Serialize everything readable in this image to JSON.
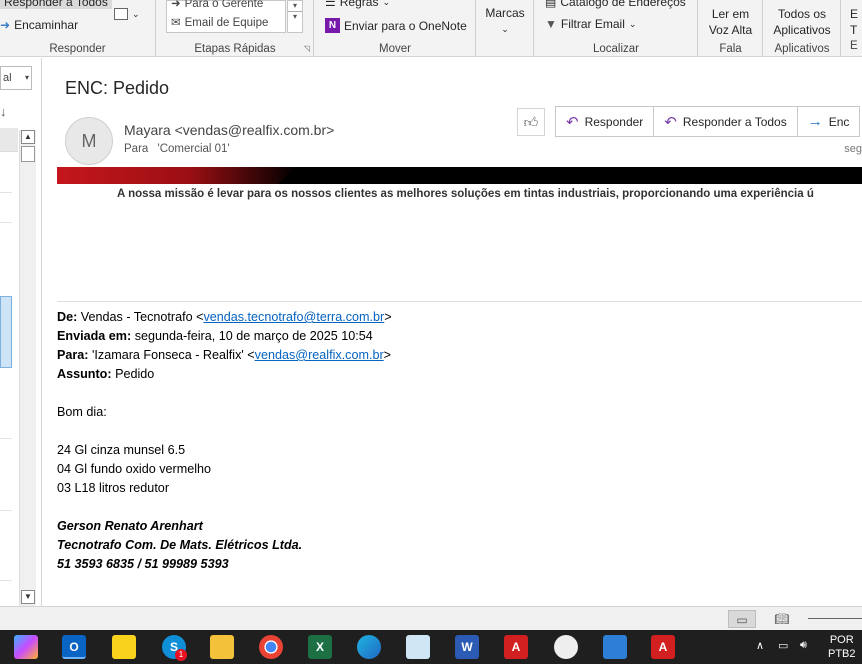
{
  "ribbon": {
    "responder": {
      "reply_all": "Responder a Todos",
      "forward": "Encaminhar",
      "label": "Responder"
    },
    "quick_steps": {
      "item1": "Para o Gerente",
      "item2": "Email de Equipe",
      "label": "Etapas Rápidas"
    },
    "mover": {
      "rules": "Regras",
      "onenote": "Enviar para o OneNote",
      "label": "Mover"
    },
    "marcas": {
      "label": "Marcas"
    },
    "localizar": {
      "address_book": "Catálogo de Endereços",
      "filter": "Filtrar Email",
      "label": "Localizar"
    },
    "fala": {
      "read_aloud_line1": "Ler em",
      "read_aloud_line2": "Voz Alta",
      "label": "Fala"
    },
    "aplicativos": {
      "all_apps_line1": "Todos os",
      "all_apps_line2": "Aplicativos",
      "label": "Aplicativos"
    },
    "cut_label_1": "E",
    "cut_label_2": "T",
    "cut_label_3": "E"
  },
  "left_pane": {
    "dropdown_value": "al",
    "sort_glyph": "↓"
  },
  "message": {
    "subject": "ENC: Pedido",
    "avatar_initial": "M",
    "sender": "Mayara <vendas@realfix.com.br>",
    "to_label": "Para",
    "to_value": "'Comercial 01'",
    "date_partial": "seg",
    "actions": {
      "reply": "Responder",
      "reply_all": "Responder a Todos",
      "forward": "Enc"
    }
  },
  "banner": {
    "mission": "A nossa missão é levar para os nossos clientes as melhores soluções em tintas industriais, proporcionando uma experiência ú"
  },
  "body": {
    "from_label": "De:",
    "from_name": "Vendas - Tecnotrafo <",
    "from_email": "vendas.tecnotrafo@terra.com.br",
    "from_close": ">",
    "sent_label": "Enviada em:",
    "sent_value": "segunda-feira, 10 de março de 2025 10:54",
    "to_label": "Para:",
    "to_name": "'Izamara Fonseca - Realfix' <",
    "to_email": "vendas@realfix.com.br",
    "to_close": ">",
    "subject_label": "Assunto:",
    "subject_value": "Pedido",
    "greeting": "Bom dia:",
    "lines": [
      "24 Gl cinza munsel 6.5",
      "04 Gl fundo oxido vermelho",
      "03 L18 litros redutor"
    ],
    "signature": [
      "Gerson Renato Arenhart",
      "Tecnotrafo Com. De Mats. Elétricos Ltda.",
      "51 3593 6835 / 51 99989 5393"
    ]
  },
  "taskbar": {
    "lang_line1": "POR",
    "lang_line2": "PTB2",
    "skype_badge": "1"
  }
}
